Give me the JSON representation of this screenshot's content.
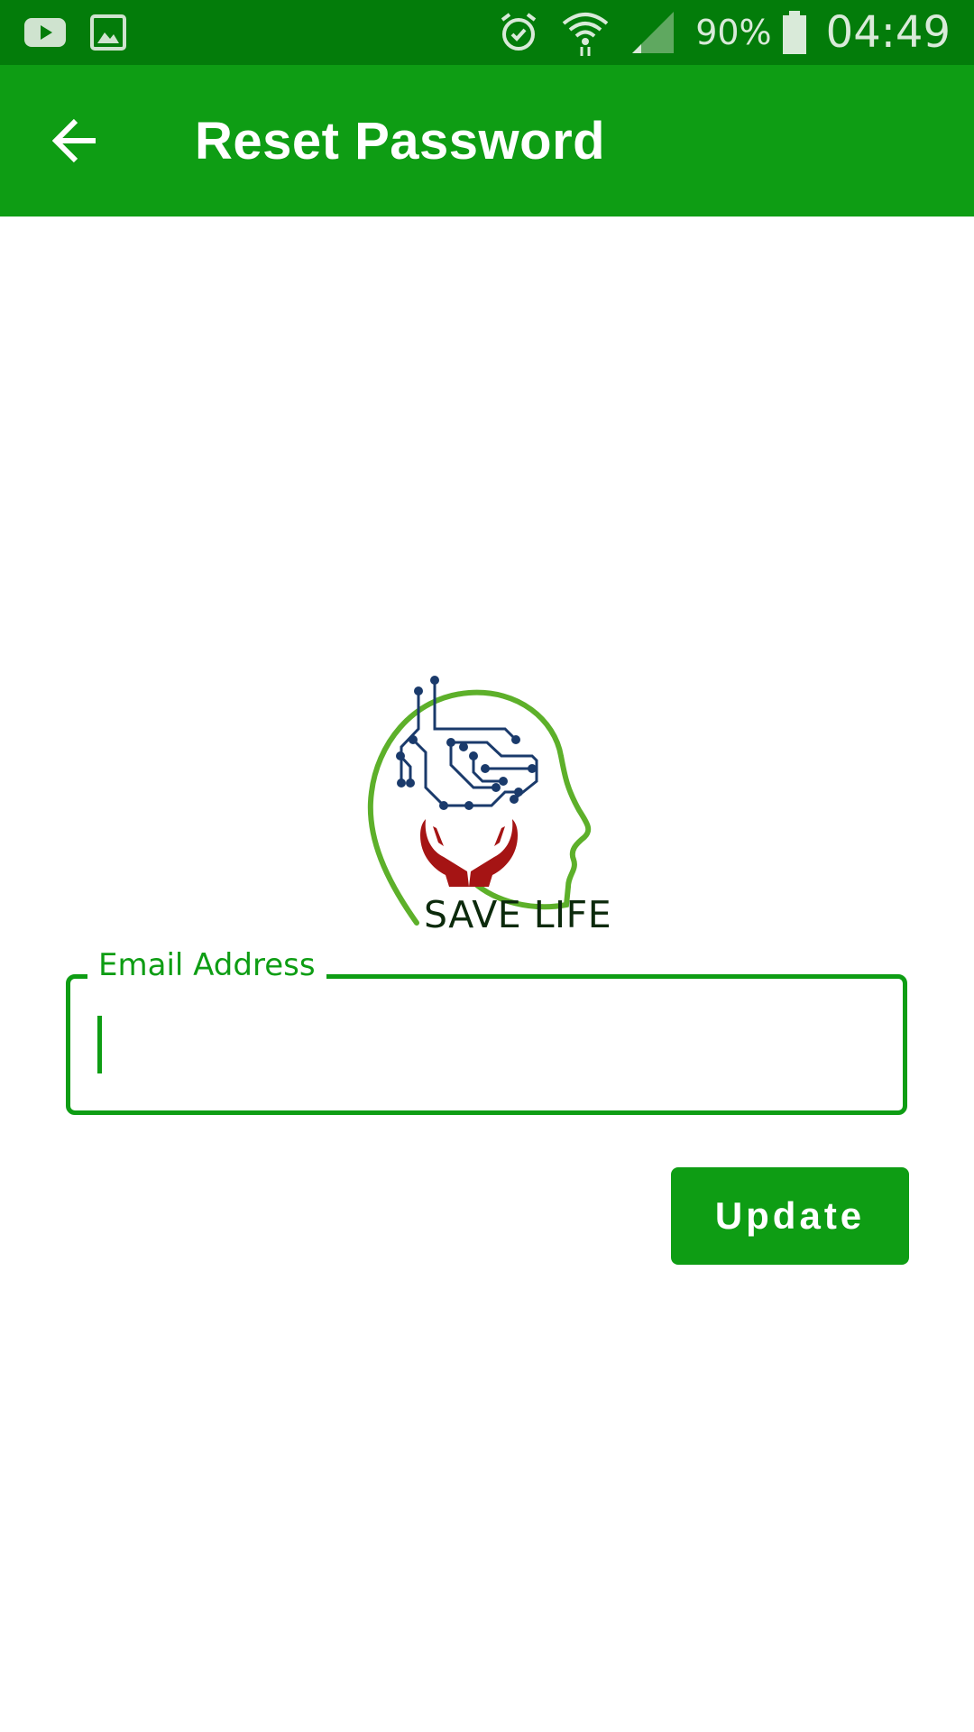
{
  "status_bar": {
    "battery_percent": "90%",
    "time": "04:49",
    "icons": [
      "youtube-icon",
      "gallery-icon",
      "alarm-icon",
      "wifi-icon",
      "signal-icon",
      "battery-icon"
    ]
  },
  "app_bar": {
    "title": "Reset Password",
    "back_icon": "arrow-left-icon"
  },
  "logo": {
    "text": "SAVE LIFE"
  },
  "form": {
    "email_label": "Email Address",
    "email_value": "",
    "update_label": "Update"
  },
  "colors": {
    "status_bar": "#037C0A",
    "primary": "#0E9D14",
    "logo_outline": "#5DB02A",
    "circuit": "#1A3A6B",
    "hands": "#A51414"
  }
}
